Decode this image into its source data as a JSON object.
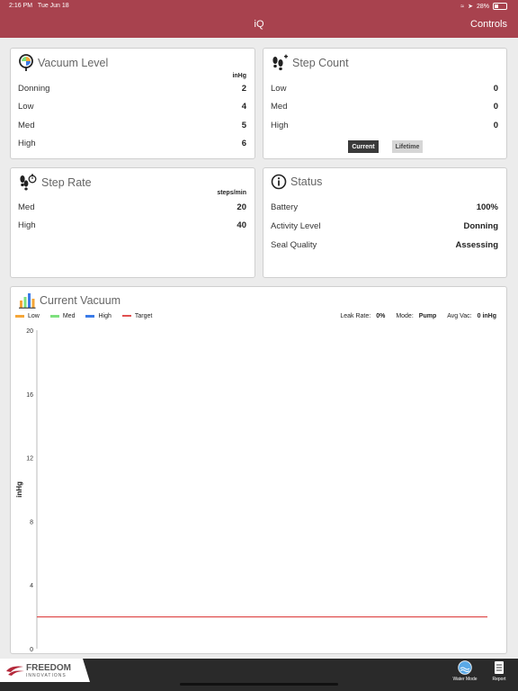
{
  "status_bar": {
    "time": "2:16 PM",
    "date": "Tue Jun 18",
    "battery": "28%"
  },
  "nav": {
    "title": "iQ",
    "controls_label": "Controls"
  },
  "vacuum_level": {
    "title": "Vacuum Level",
    "unit": "inHg",
    "rows": [
      {
        "label": "Donning",
        "value": "2"
      },
      {
        "label": "Low",
        "value": "4"
      },
      {
        "label": "Med",
        "value": "5"
      },
      {
        "label": "High",
        "value": "6"
      }
    ]
  },
  "step_count": {
    "title": "Step Count",
    "rows": [
      {
        "label": "Low",
        "value": "0"
      },
      {
        "label": "Med",
        "value": "0"
      },
      {
        "label": "High",
        "value": "0"
      }
    ],
    "current_label": "Current",
    "lifetime_label": "Lifetime"
  },
  "step_rate": {
    "title": "Step Rate",
    "unit": "steps/min",
    "rows": [
      {
        "label": "Med",
        "value": "20"
      },
      {
        "label": "High",
        "value": "40"
      }
    ]
  },
  "status": {
    "title": "Status",
    "rows": [
      {
        "label": "Battery",
        "value": "100%"
      },
      {
        "label": "Activity Level",
        "value": "Donning"
      },
      {
        "label": "Seal Quality",
        "value": "Assessing"
      }
    ]
  },
  "current_vacuum": {
    "title": "Current Vacuum",
    "legend": [
      "Low",
      "Med",
      "High",
      "Target"
    ],
    "leak_rate_label": "Leak Rate:",
    "leak_rate_value": "0%",
    "mode_label": "Mode:",
    "mode_value": "Pump",
    "avg_vac_label": "Avg Vac:",
    "avg_vac_value": "0 inHg"
  },
  "colors": {
    "brand": "#a8424e",
    "low": "#f5a638",
    "med": "#7ee07e",
    "high": "#3b7be8",
    "target": "#e05050"
  },
  "chart_data": {
    "type": "line",
    "ylabel": "inHg",
    "ylim": [
      0,
      20
    ],
    "yticks": [
      "20",
      "16",
      "12",
      "8",
      "4",
      "0"
    ],
    "series": [
      {
        "name": "Target",
        "values": [
          2,
          2
        ]
      }
    ]
  },
  "bottom": {
    "logo_line1": "FREEDOM",
    "logo_line2": "INNOVATIONS",
    "water_mode_label": "Water Mode",
    "report_label": "Report"
  }
}
